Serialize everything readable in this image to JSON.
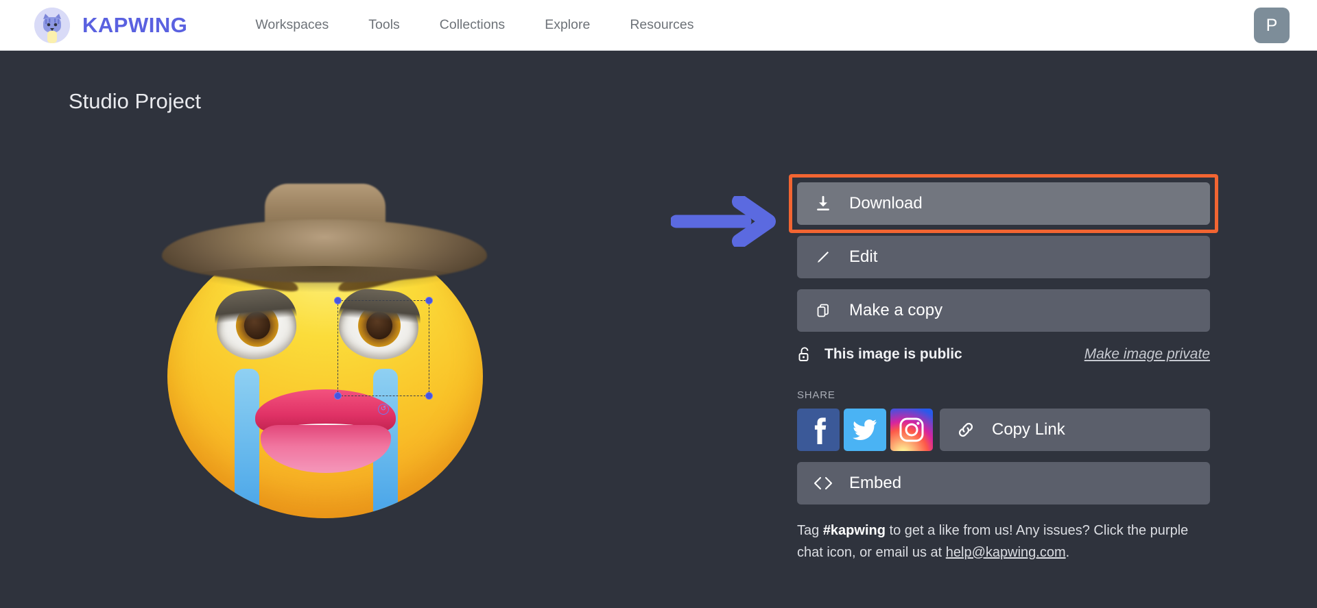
{
  "header": {
    "brand_name": "KAPWING",
    "brand_icon": "kapwing-cat-logo",
    "nav": [
      {
        "label": "Workspaces"
      },
      {
        "label": "Tools"
      },
      {
        "label": "Collections"
      },
      {
        "label": "Explore"
      },
      {
        "label": "Resources"
      }
    ],
    "avatar_initial": "P"
  },
  "page": {
    "title": "Studio Project"
  },
  "canvas": {
    "content_description": "cowboy-hat-crying-face-with-lips-emoji",
    "selection": {
      "target": "right-eye-layer",
      "handles": [
        "top-left",
        "top-right",
        "bottom-left",
        "bottom-right"
      ],
      "rotate_handle_icon": "rotate-icon"
    }
  },
  "annotation": {
    "arrow_icon": "right-arrow-annotation",
    "arrow_color": "#5b6ae0",
    "highlight_color": "#f26532",
    "highlight_target": "download-button"
  },
  "panel": {
    "actions": [
      {
        "label": "Download",
        "icon": "download-icon",
        "highlighted": true
      },
      {
        "label": "Edit",
        "icon": "pencil-icon",
        "highlighted": false
      },
      {
        "label": "Make a copy",
        "icon": "copy-icon",
        "highlighted": false
      }
    ],
    "visibility": {
      "icon": "unlocked-padlock-icon",
      "status": "This image is public",
      "toggle_link": "Make image private"
    },
    "share": {
      "section_label": "SHARE",
      "networks": [
        {
          "name": "facebook",
          "icon": "facebook-icon"
        },
        {
          "name": "twitter",
          "icon": "twitter-icon"
        },
        {
          "name": "instagram",
          "icon": "instagram-icon"
        }
      ],
      "copy_link": {
        "label": "Copy Link",
        "icon": "chain-link-icon"
      },
      "embed": {
        "label": "Embed",
        "icon": "code-brackets-icon"
      }
    },
    "footnote": {
      "part1": "Tag ",
      "hashtag": "#kapwing",
      "part2": " to get a like from us! Any issues? Click the purple chat icon, or email us at ",
      "email": "help@kapwing.com",
      "part3": "."
    }
  },
  "colors": {
    "page_background": "#2f333d",
    "header_background": "#ffffff",
    "button_background": "#5b5f6b",
    "button_hover_background": "#72767f",
    "brand_purple": "#5a61e0",
    "highlight_orange": "#f26532",
    "arrow_blue": "#5b6ae0"
  }
}
